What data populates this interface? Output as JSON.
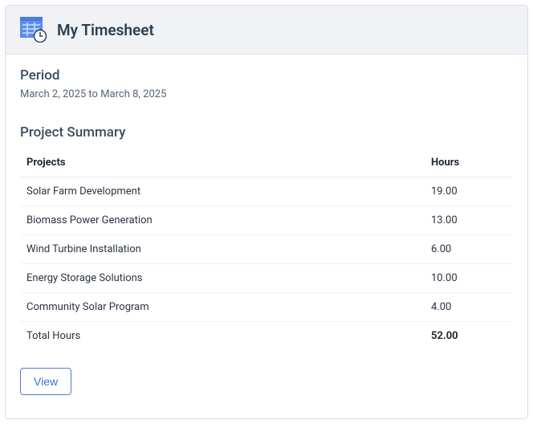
{
  "header": {
    "title": "My Timesheet"
  },
  "period": {
    "label": "Period",
    "range": "March 2, 2025 to March 8, 2025"
  },
  "summary": {
    "title": "Project Summary",
    "columns": {
      "projects": "Projects",
      "hours": "Hours"
    },
    "rows": [
      {
        "project": "Solar Farm Development",
        "hours": "19.00"
      },
      {
        "project": "Biomass Power Generation",
        "hours": "13.00"
      },
      {
        "project": "Wind Turbine Installation",
        "hours": "6.00"
      },
      {
        "project": "Energy Storage Solutions",
        "hours": "10.00"
      },
      {
        "project": "Community Solar Program",
        "hours": "4.00"
      }
    ],
    "total": {
      "label": "Total Hours",
      "value": "52.00"
    }
  },
  "actions": {
    "view": "View"
  }
}
